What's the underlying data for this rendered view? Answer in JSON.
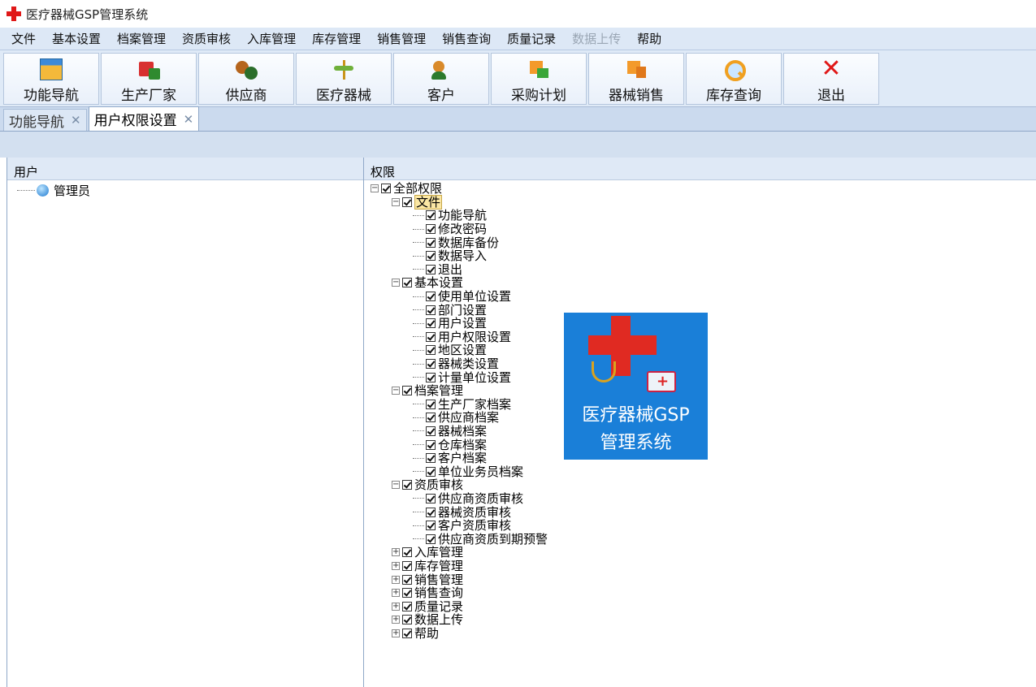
{
  "window": {
    "title": "医疗器械GSP管理系统"
  },
  "menu": [
    {
      "label": "文件",
      "disabled": false
    },
    {
      "label": "基本设置",
      "disabled": false
    },
    {
      "label": "档案管理",
      "disabled": false
    },
    {
      "label": "资质审核",
      "disabled": false
    },
    {
      "label": "入库管理",
      "disabled": false
    },
    {
      "label": "库存管理",
      "disabled": false
    },
    {
      "label": "销售管理",
      "disabled": false
    },
    {
      "label": "销售查询",
      "disabled": false
    },
    {
      "label": "质量记录",
      "disabled": false
    },
    {
      "label": "数据上传",
      "disabled": true
    },
    {
      "label": "帮助",
      "disabled": false
    }
  ],
  "toolbar": [
    {
      "label": "功能导航",
      "icon": "navigation-icon"
    },
    {
      "label": "生产厂家",
      "icon": "factory-icon"
    },
    {
      "label": "供应商",
      "icon": "supplier-icon"
    },
    {
      "label": "医疗器械",
      "icon": "device-icon"
    },
    {
      "label": "客户",
      "icon": "customer-icon"
    },
    {
      "label": "采购计划",
      "icon": "purchase-plan-icon"
    },
    {
      "label": "器械销售",
      "icon": "device-sale-icon"
    },
    {
      "label": "库存查询",
      "icon": "inventory-search-icon"
    },
    {
      "label": "退出",
      "icon": "exit-icon"
    }
  ],
  "tabs": [
    {
      "label": "功能导航",
      "active": false
    },
    {
      "label": "用户权限设置",
      "active": true
    }
  ],
  "users_panel": {
    "header": "用户",
    "users": [
      "管理员"
    ]
  },
  "permissions_panel": {
    "header": "权限",
    "root": "全部权限",
    "groups": [
      {
        "label": "文件",
        "expanded": true,
        "highlight": true,
        "items": [
          "功能导航",
          "修改密码",
          "数据库备份",
          "数据导入",
          "退出"
        ]
      },
      {
        "label": "基本设置",
        "expanded": true,
        "items": [
          "使用单位设置",
          "部门设置",
          "用户设置",
          "用户权限设置",
          "地区设置",
          "器械类设置",
          "计量单位设置"
        ]
      },
      {
        "label": "档案管理",
        "expanded": true,
        "items": [
          "生产厂家档案",
          "供应商档案",
          "器械档案",
          "仓库档案",
          "客户档案",
          "单位业务员档案"
        ]
      },
      {
        "label": "资质审核",
        "expanded": true,
        "items": [
          "供应商资质审核",
          "器械资质审核",
          "客户资质审核",
          "供应商资质到期预警"
        ]
      },
      {
        "label": "入库管理",
        "expanded": false,
        "items": []
      },
      {
        "label": "库存管理",
        "expanded": false,
        "items": []
      },
      {
        "label": "销售管理",
        "expanded": false,
        "items": []
      },
      {
        "label": "销售查询",
        "expanded": false,
        "items": []
      },
      {
        "label": "质量记录",
        "expanded": false,
        "items": []
      },
      {
        "label": "数据上传",
        "expanded": false,
        "items": []
      },
      {
        "label": "帮助",
        "expanded": false,
        "items": []
      }
    ]
  },
  "splash": {
    "line1": "医疗器械GSP",
    "line2": "管理系统"
  },
  "colors": {
    "accent_red": "#e01818",
    "splash_blue": "#1a7fd8",
    "menu_bg": "#dde8f6"
  }
}
